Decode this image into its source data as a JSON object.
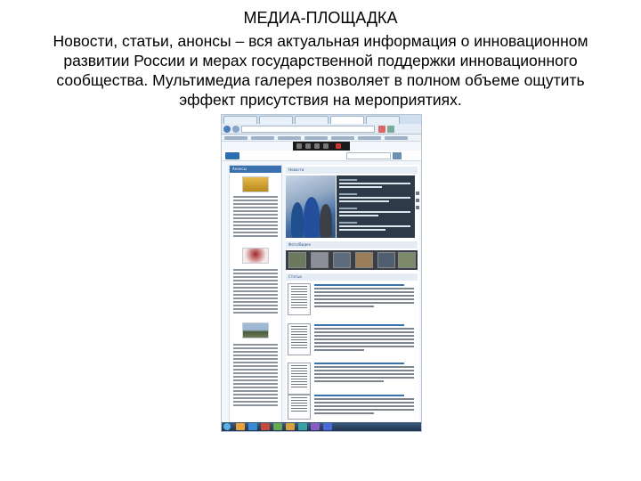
{
  "slide": {
    "title": "МЕДИА-ПЛОЩАДКА",
    "body": "Новости, статьи, анонсы – вся актуальная информация о инновационном развитии России и мерах государственной поддержки инновационного сообщества. Мультимедиа галерея позволяет в полном объеме ощутить эффект присутствия на мероприятиях."
  },
  "screenshot": {
    "sections": {
      "announcements": "Анонсы",
      "news": "Новости",
      "media": "Фото/Видео",
      "articles": "Статьи"
    }
  },
  "colors": {
    "site_blue": "#3a70ad",
    "dark_panel": "#2e3a48",
    "taskbar": "#1e3450"
  }
}
